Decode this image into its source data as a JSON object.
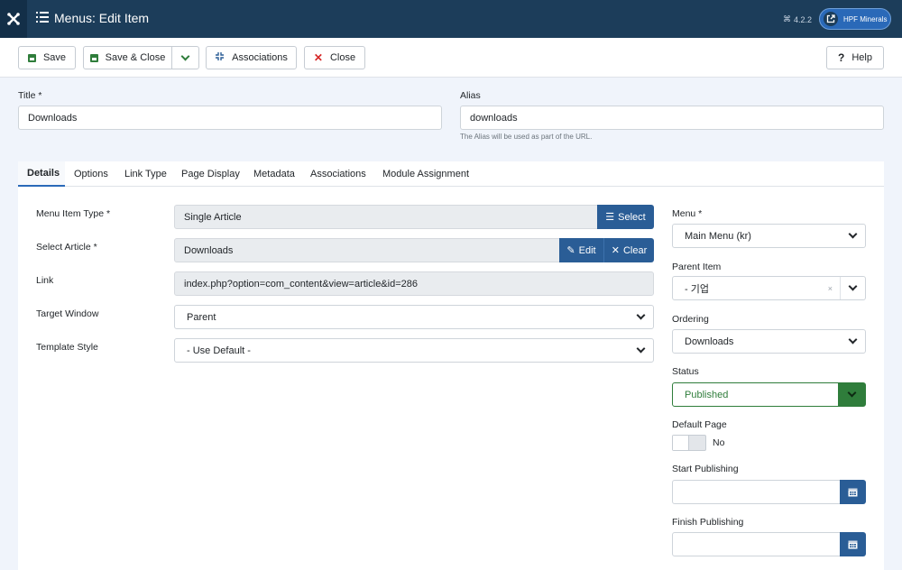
{
  "header": {
    "title": "Menus: Edit Item",
    "version": "4.2.2",
    "site_name": "HPF Minerals"
  },
  "toolbar": {
    "save": "Save",
    "save_close": "Save & Close",
    "associations": "Associations",
    "close": "Close",
    "help": "Help"
  },
  "form": {
    "title_label": "Title *",
    "title_value": "Downloads",
    "alias_label": "Alias",
    "alias_value": "downloads",
    "alias_hint": "The Alias will be used as part of the URL."
  },
  "tabs": [
    "Details",
    "Options",
    "Link Type",
    "Page Display",
    "Metadata",
    "Associations",
    "Module Assignment"
  ],
  "details": {
    "menu_item_type_label": "Menu Item Type *",
    "menu_item_type_value": "Single Article",
    "select_btn": "Select",
    "select_article_label": "Select Article *",
    "select_article_value": "Downloads",
    "edit_btn": "Edit",
    "clear_btn": "Clear",
    "link_label": "Link",
    "link_value": "index.php?option=com_content&view=article&id=286",
    "target_window_label": "Target Window",
    "target_window_value": "Parent",
    "template_style_label": "Template Style",
    "template_style_value": "- Use Default -"
  },
  "sidebar": {
    "menu_label": "Menu *",
    "menu_value": "Main Menu (kr)",
    "parent_label": "Parent Item",
    "parent_value": "- 기업",
    "ordering_label": "Ordering",
    "ordering_value": "Downloads",
    "status_label": "Status",
    "status_value": "Published",
    "default_page_label": "Default Page",
    "default_page_value": "No",
    "start_publishing_label": "Start Publishing",
    "finish_publishing_label": "Finish Publishing"
  },
  "colors": {
    "header_bg": "#1c3d5a",
    "primary_blue": "#2a5d96",
    "success_green": "#2f7d3b",
    "close_red": "#d62828"
  }
}
